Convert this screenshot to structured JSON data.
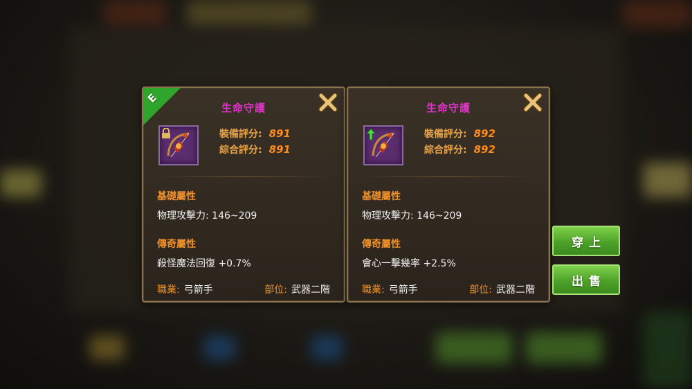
{
  "left_panel": {
    "badge": "E",
    "title": "生命守護",
    "equip_score_label": "裝備評分:",
    "equip_score": "891",
    "total_score_label": "綜合評分:",
    "total_score": "891",
    "basic_attr_title": "基礎屬性",
    "basic_attr": "物理攻擊力: 146~209",
    "legend_attr_title": "傳奇屬性",
    "legend_attr": "殺怪魔法回復 +0.7%",
    "class_label": "職業:",
    "class_value": "弓箭手",
    "slot_label": "部位:",
    "slot_value": "武器二階"
  },
  "right_panel": {
    "title": "生命守護",
    "equip_score_label": "裝備評分:",
    "equip_score": "892",
    "total_score_label": "綜合評分:",
    "total_score": "892",
    "basic_attr_title": "基礎屬性",
    "basic_attr": "物理攻擊力: 146~209",
    "legend_attr_title": "傳奇屬性",
    "legend_attr": "會心一擊幾率 +2.5%",
    "class_label": "職業:",
    "class_value": "弓箭手",
    "slot_label": "部位:",
    "slot_value": "武器二階"
  },
  "actions": {
    "equip_label": "穿上",
    "sell_label": "出售"
  },
  "colors": {
    "title": "#e033c9",
    "label": "#f09028",
    "score": "#ff8a1e",
    "button": "#4ea22a"
  }
}
